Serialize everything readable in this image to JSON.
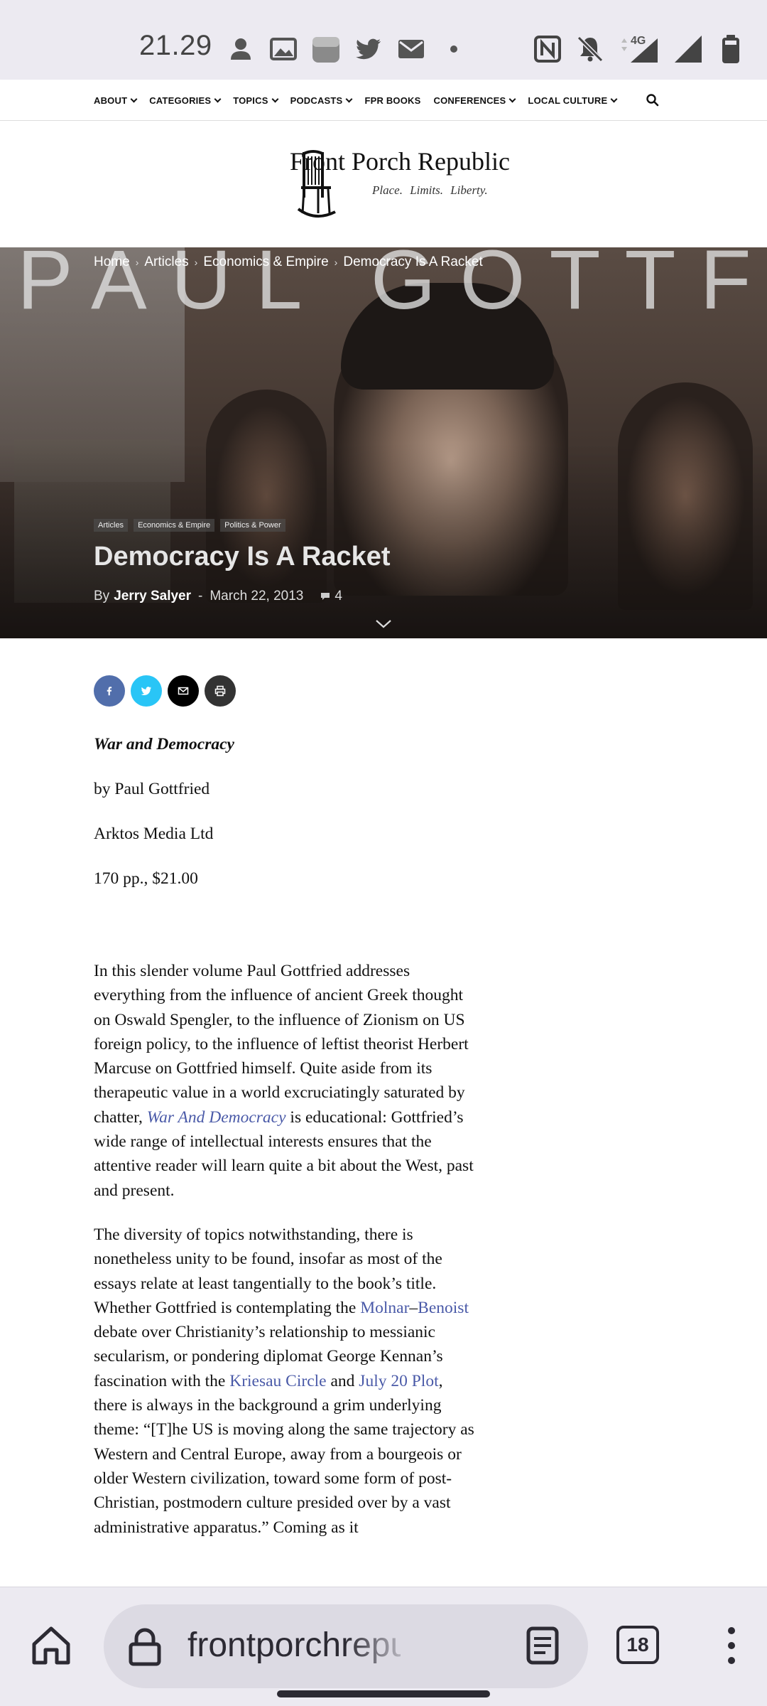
{
  "status_bar": {
    "time": "21.29",
    "network": "4G"
  },
  "nav": {
    "items": [
      {
        "label": "ABOUT",
        "dropdown": true
      },
      {
        "label": "CATEGORIES",
        "dropdown": true
      },
      {
        "label": "TOPICS",
        "dropdown": true
      },
      {
        "label": "PODCASTS",
        "dropdown": true
      },
      {
        "label": "FPR BOOKS",
        "dropdown": false
      },
      {
        "label": "CONFERENCES",
        "dropdown": true
      },
      {
        "label": "LOCAL CULTURE",
        "dropdown": true
      }
    ]
  },
  "logo": {
    "title": "Front Porch Republic",
    "tagline": "Place.  Limits.  Liberty."
  },
  "hero": {
    "image_text": "PAUL GOTTFRIED",
    "breadcrumb": [
      "Home",
      "Articles",
      "Economics & Empire",
      "Democracy Is A Racket"
    ],
    "tags": [
      "Articles",
      "Economics & Empire",
      "Politics & Power"
    ],
    "title": "Democracy Is A Racket",
    "by": "By",
    "author": "Jerry Salyer",
    "date": "March 22, 2013",
    "comment_count": "4"
  },
  "share": {
    "buttons": [
      "facebook",
      "twitter",
      "email",
      "print"
    ],
    "colors": {
      "facebook": "#516eab",
      "twitter": "#29c5f6",
      "email": "#000000",
      "print": "#333333"
    }
  },
  "article": {
    "book_title": "War and Democracy",
    "book_author": "by Paul Gottfried",
    "publisher": "Arktos Media Ltd",
    "price": "170 pp., $21.00",
    "p1_a": "In this slender volume Paul Gottfried addresses everything from the influence of ancient Greek thought on Oswald Spengler, to the influence of Zionism on US foreign policy, to the influence of leftist theorist Herbert Marcuse on Gottfried himself. Quite aside from its therapeutic value in a world excruciatingly saturated by chatter, ",
    "p1_link": "War And Democracy",
    "p1_b": " is educational: Gottfried’s wide range of intellectual interests ensures that the attentive reader will learn quite a bit about the West, past and present.",
    "p2_a": "The diversity of topics notwithstanding, there is nonetheless unity to be found, insofar as most of the essays relate at least tangentially to the book’s title. Whether Gottfried is contemplating the ",
    "p2_link1": "Molnar",
    "p2_dash": "–",
    "p2_link2": "Benoist",
    "p2_b": " debate over Christianity’s relationship to messianic secularism, or pondering diplomat George Kennan’s fascination with the ",
    "p2_link3": "Kriesau Circle",
    "p2_and": " and ",
    "p2_link4": "July 20 Plot",
    "p2_c": ", there is always in the background a grim underlying theme: “[T]he US is moving along the same trajectory as Western and Central Europe, away from a bourgeois or older Western civilization, toward some form of post-Christian, postmodern culture presided over by a vast administrative apparatus.” Coming as it"
  },
  "browser": {
    "url": "frontporchrepublic.com",
    "tab_count": "18"
  },
  "colors": {
    "link": "#4a5aa8",
    "chrome_bg": "#eceaf1",
    "url_pill": "#dcdae3"
  }
}
